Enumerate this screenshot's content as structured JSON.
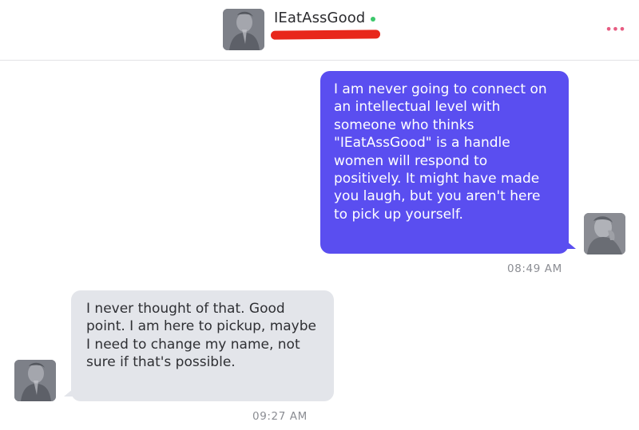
{
  "header": {
    "contact_name": "IEatAssGood",
    "status": "online",
    "menu_icon": "more-dots-icon",
    "more_glyph": "•••",
    "accent_colors": {
      "online_dot": "#3cc76b",
      "menu_dots": "#e75c82",
      "redaction": "#e8271b"
    }
  },
  "messages": [
    {
      "direction": "sent",
      "text": "I am never going to connect on an intellectual level with someone who thinks \"IEatAssGood\" is a handle women will respond to positively. It might have made you laugh, but you aren't here to pick up yourself.",
      "time": "08:49 AM",
      "bubble_color": "#5a4ef0"
    },
    {
      "direction": "received",
      "text": "I never thought of that. Good point. I am here to pickup, maybe I need to change my name, not sure if that's possible.",
      "time": "09:27 AM",
      "bubble_color": "#e3e5ea"
    }
  ]
}
